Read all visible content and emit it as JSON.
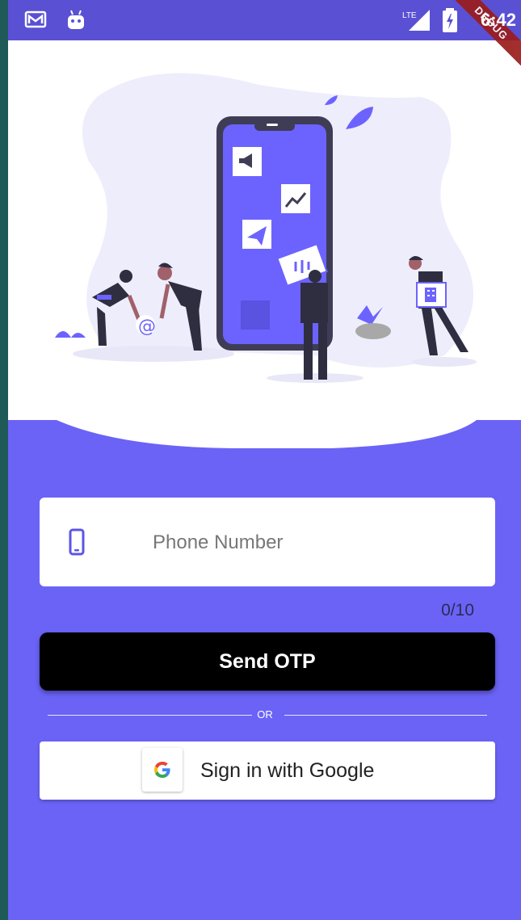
{
  "status_bar": {
    "time": "6:42",
    "network": "LTE",
    "debug_banner": "DEBUG",
    "icons": [
      "gmail-icon",
      "android-icon",
      "signal-icon",
      "battery-icon"
    ]
  },
  "login": {
    "phone_placeholder": "Phone Number",
    "phone_value": "",
    "phone_counter": "0/10",
    "send_otp_label": "Send OTP",
    "divider_label": "OR",
    "google_label": "Sign in with Google"
  },
  "colors": {
    "background": "#6b63f6",
    "status_bar": "#5a50d4",
    "accent": "#6c63ff",
    "button": "#000000"
  },
  "illustration": {
    "icons": [
      "megaphone-icon",
      "chart-icon",
      "paper-plane-icon",
      "at-sign-icon",
      "building-icon"
    ]
  }
}
